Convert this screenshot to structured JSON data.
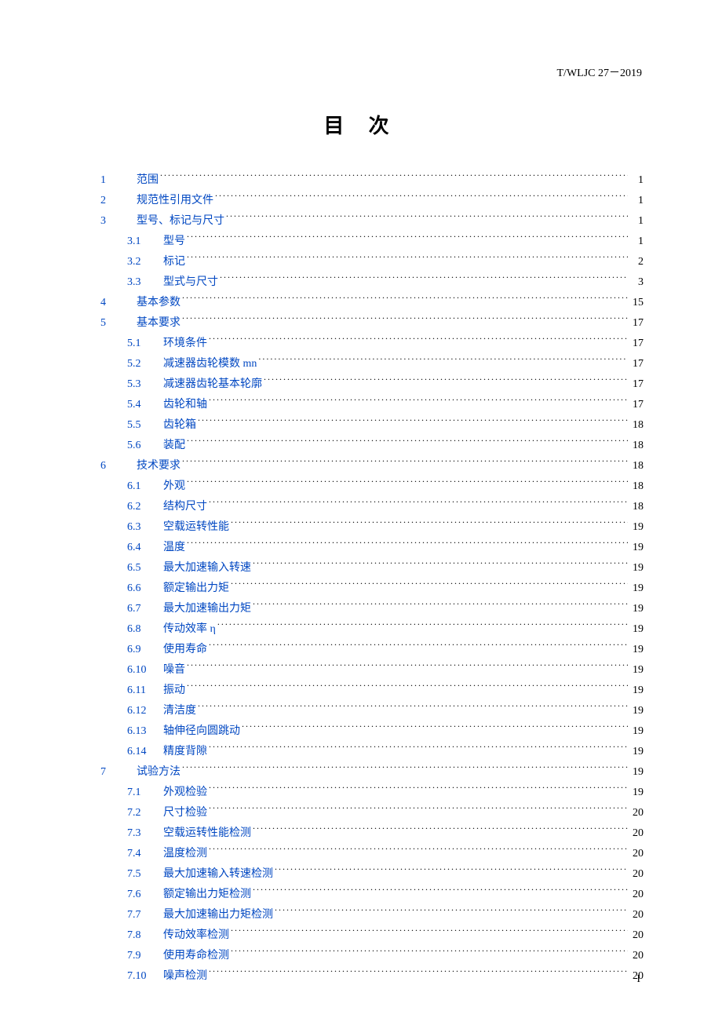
{
  "docId": "T/WLJC 27－2019",
  "title": "目  次",
  "pageNumber": "I",
  "toc": [
    {
      "level": 1,
      "num": "1",
      "label": "范围",
      "page": "1"
    },
    {
      "level": 1,
      "num": "2",
      "label": "规范性引用文件",
      "page": "1"
    },
    {
      "level": 1,
      "num": "3",
      "label": "型号、标记与尺寸",
      "page": "1"
    },
    {
      "level": 2,
      "num": "3.1",
      "label": "型号",
      "page": "1"
    },
    {
      "level": 2,
      "num": "3.2",
      "label": "标记",
      "page": "2"
    },
    {
      "level": 2,
      "num": "3.3",
      "label": "型式与尺寸",
      "page": "3"
    },
    {
      "level": 1,
      "num": "4",
      "label": "基本参数",
      "page": "15"
    },
    {
      "level": 1,
      "num": "5",
      "label": "基本要求",
      "page": "17"
    },
    {
      "level": 2,
      "num": "5.1",
      "label": "环境条件",
      "page": "17"
    },
    {
      "level": 2,
      "num": "5.2",
      "label": "减速器齿轮模数 mn",
      "page": "17"
    },
    {
      "level": 2,
      "num": "5.3",
      "label": "减速器齿轮基本轮廓",
      "page": "17"
    },
    {
      "level": 2,
      "num": "5.4",
      "label": "齿轮和轴",
      "page": "17"
    },
    {
      "level": 2,
      "num": "5.5",
      "label": "齿轮箱",
      "page": "18"
    },
    {
      "level": 2,
      "num": "5.6",
      "label": "装配",
      "page": "18"
    },
    {
      "level": 1,
      "num": "6",
      "label": "技术要求",
      "page": "18"
    },
    {
      "level": 2,
      "num": "6.1",
      "label": "外观",
      "page": "18"
    },
    {
      "level": 2,
      "num": "6.2",
      "label": "结构尺寸",
      "page": "18"
    },
    {
      "level": 2,
      "num": "6.3",
      "label": "空载运转性能",
      "page": "19"
    },
    {
      "level": 2,
      "num": "6.4",
      "label": "温度",
      "page": "19"
    },
    {
      "level": 2,
      "num": "6.5",
      "label": "最大加速输入转速",
      "page": "19"
    },
    {
      "level": 2,
      "num": "6.6",
      "label": "额定输出力矩",
      "page": "19"
    },
    {
      "level": 2,
      "num": "6.7",
      "label": "最大加速输出力矩",
      "page": "19"
    },
    {
      "level": 2,
      "num": "6.8",
      "label": "传动效率 η",
      "page": "19"
    },
    {
      "level": 2,
      "num": "6.9",
      "label": "使用寿命",
      "page": "19"
    },
    {
      "level": 2,
      "num": "6.10",
      "label": "噪音",
      "page": "19"
    },
    {
      "level": 2,
      "num": "6.11",
      "label": "振动",
      "page": "19"
    },
    {
      "level": 2,
      "num": "6.12",
      "label": "清洁度",
      "page": "19"
    },
    {
      "level": 2,
      "num": "6.13",
      "label": "轴伸径向圆跳动",
      "page": "19"
    },
    {
      "level": 2,
      "num": "6.14",
      "label": "精度背隙",
      "page": "19"
    },
    {
      "level": 1,
      "num": "7",
      "label": "试验方法",
      "page": "19"
    },
    {
      "level": 2,
      "num": "7.1",
      "label": "外观检验",
      "page": "19"
    },
    {
      "level": 2,
      "num": "7.2",
      "label": "尺寸检验",
      "page": "20"
    },
    {
      "level": 2,
      "num": "7.3",
      "label": "空载运转性能检测",
      "page": "20"
    },
    {
      "level": 2,
      "num": "7.4",
      "label": "温度检测",
      "page": "20"
    },
    {
      "level": 2,
      "num": "7.5",
      "label": "最大加速输入转速检测",
      "page": "20"
    },
    {
      "level": 2,
      "num": "7.6",
      "label": "额定输出力矩检测",
      "page": "20"
    },
    {
      "level": 2,
      "num": "7.7",
      "label": "最大加速输出力矩检测",
      "page": "20"
    },
    {
      "level": 2,
      "num": "7.8",
      "label": "传动效率检测",
      "page": "20"
    },
    {
      "level": 2,
      "num": "7.9",
      "label": "使用寿命检测",
      "page": "20"
    },
    {
      "level": 2,
      "num": "7.10",
      "label": "噪声检测",
      "page": "20"
    }
  ]
}
